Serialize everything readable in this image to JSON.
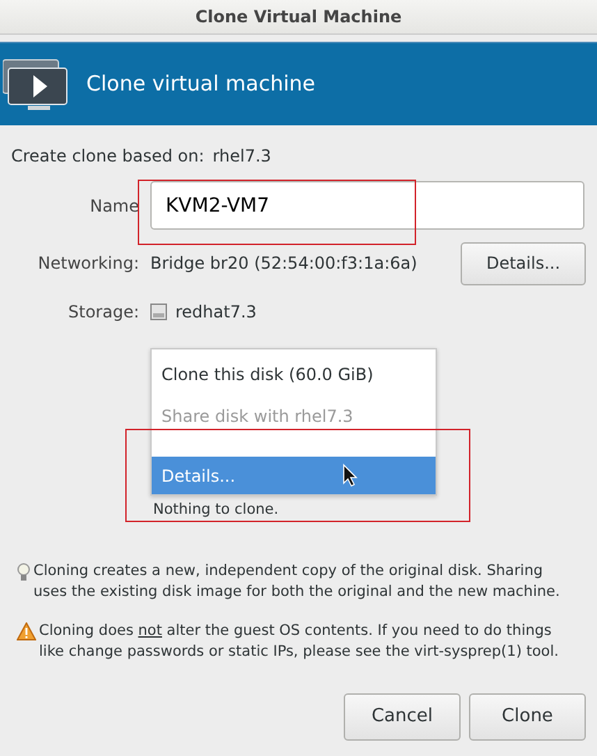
{
  "window": {
    "title": "Clone Virtual Machine"
  },
  "header": {
    "title": "Clone virtual machine"
  },
  "source": {
    "label": "Create clone based on:",
    "value": "rhel7.3"
  },
  "name": {
    "label": "Name",
    "value": "KVM2-VM7",
    "highlighted": true
  },
  "networking": {
    "label": "Networking:",
    "value": "Bridge br20 (52:54:00:f3:1a:6a)",
    "button": "Details..."
  },
  "storage": {
    "label": "Storage:",
    "disk": "redhat7.3",
    "status": "Nothing to clone."
  },
  "storage_menu": {
    "highlighted": true,
    "items": [
      {
        "kind": "item",
        "label": "Clone this disk (60.0 GiB)",
        "disabled": false,
        "selected": false
      },
      {
        "kind": "item",
        "label": "Share disk with rhel7.3",
        "disabled": true,
        "selected": false
      },
      {
        "kind": "separator"
      },
      {
        "kind": "item",
        "label": "Details...",
        "disabled": false,
        "selected": true
      }
    ]
  },
  "info": {
    "text": "Cloning creates a new, independent copy of the original disk. Sharing uses the existing disk image for both the original and the new machine."
  },
  "warning": {
    "segments": [
      {
        "text": "Cloning does ",
        "underlined": false
      },
      {
        "text": "not",
        "underlined": true
      },
      {
        "text": " alter the guest OS contents. If you need to do things like change passwords or static IPs, please see the virt-sysprep(1) tool.",
        "underlined": false
      }
    ]
  },
  "buttons": [
    {
      "label": "Cancel"
    },
    {
      "label": "Clone"
    }
  ]
}
